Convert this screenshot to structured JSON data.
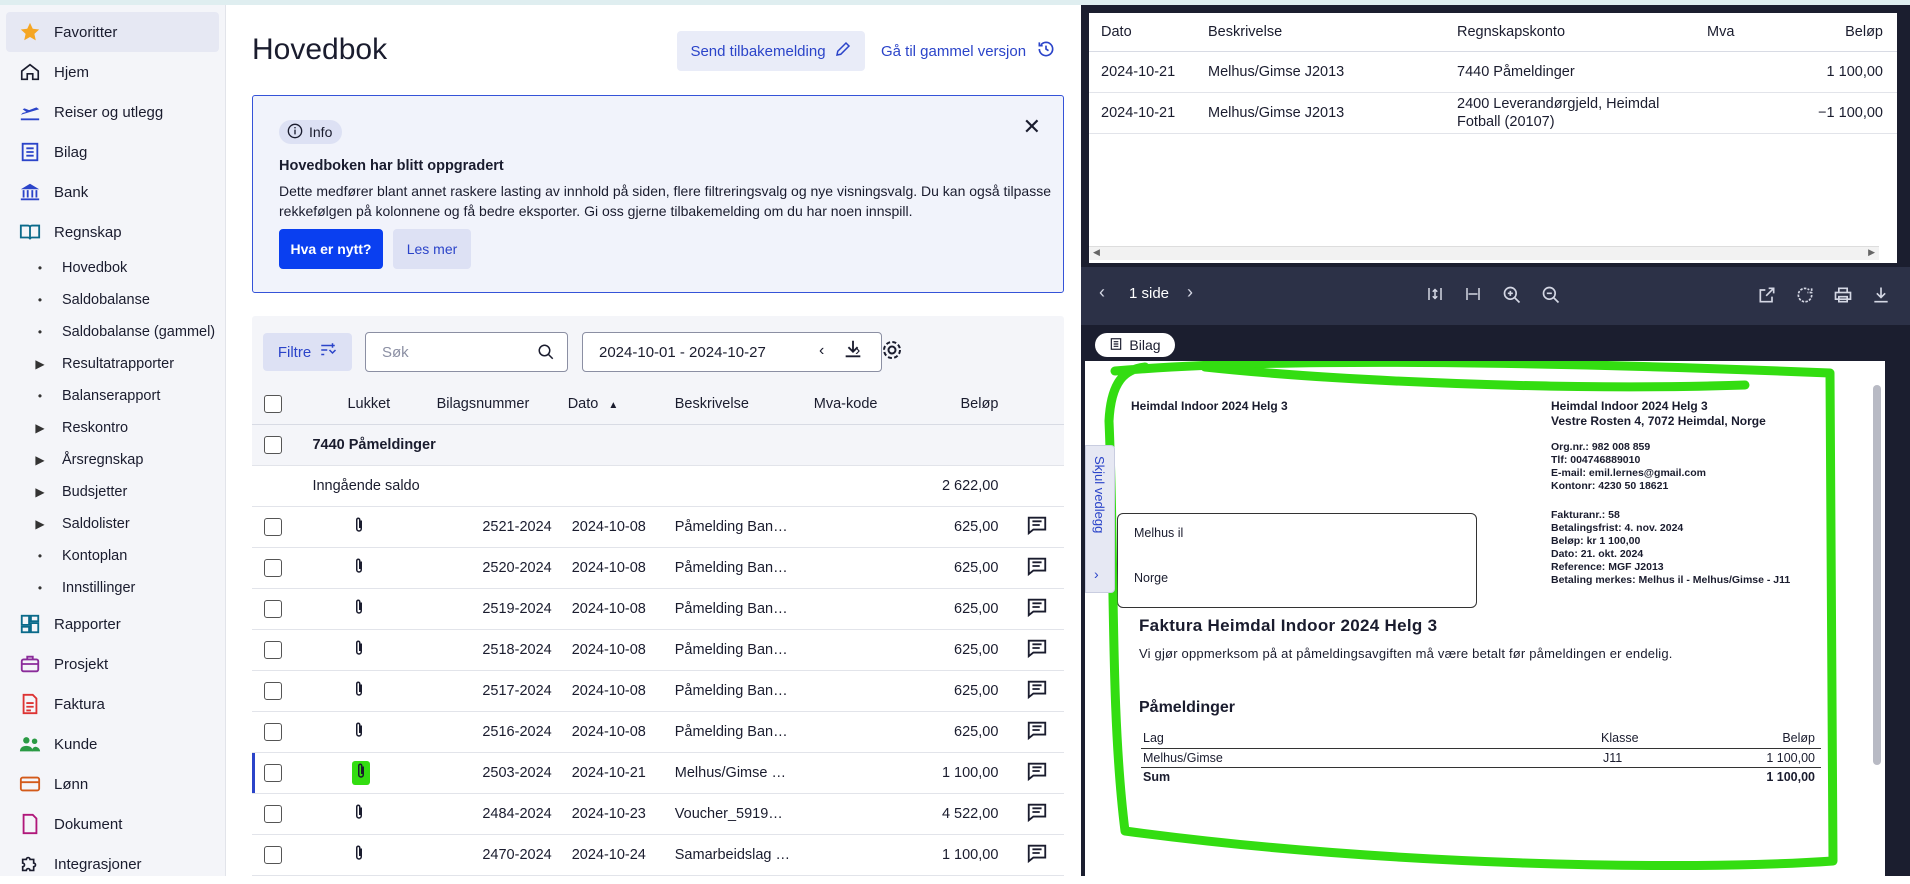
{
  "sidebar": {
    "items": [
      {
        "label": "Favoritter",
        "icon": "star-icon"
      },
      {
        "label": "Hjem",
        "icon": "home-icon"
      },
      {
        "label": "Reiser og utlegg",
        "icon": "plane-icon"
      },
      {
        "label": "Bilag",
        "icon": "document-list-icon"
      },
      {
        "label": "Bank",
        "icon": "bank-icon"
      },
      {
        "label": "Regnskap",
        "icon": "book-icon"
      }
    ],
    "sub_items": [
      {
        "label": "Hovedbok",
        "type": "dot"
      },
      {
        "label": "Saldobalanse",
        "type": "dot"
      },
      {
        "label": "Saldobalanse (gammel)",
        "type": "dot"
      },
      {
        "label": "Resultatrapporter",
        "type": "caret"
      },
      {
        "label": "Balanserapport",
        "type": "dot"
      },
      {
        "label": "Reskontro",
        "type": "caret"
      },
      {
        "label": "Årsregnskap",
        "type": "caret"
      },
      {
        "label": "Budsjetter",
        "type": "caret"
      },
      {
        "label": "Saldolister",
        "type": "caret"
      },
      {
        "label": "Kontoplan",
        "type": "dot"
      },
      {
        "label": "Innstillinger",
        "type": "dot"
      }
    ],
    "bottom_items": [
      {
        "label": "Rapporter",
        "icon": "dashboard-icon"
      },
      {
        "label": "Prosjekt",
        "icon": "briefcase-icon"
      },
      {
        "label": "Faktura",
        "icon": "invoice-icon"
      },
      {
        "label": "Kunde",
        "icon": "users-icon"
      },
      {
        "label": "Lønn",
        "icon": "wallet-icon"
      },
      {
        "label": "Dokument",
        "icon": "file-icon"
      },
      {
        "label": "Integrasjoner",
        "icon": "puzzle-icon"
      }
    ]
  },
  "header": {
    "title": "Hovedbok",
    "feedback_label": "Send tilbakemelding",
    "old_version_label": "Gå til gammel versjon"
  },
  "info": {
    "badge": "Info",
    "title": "Hovedboken har blitt oppgradert",
    "text": "Dette medfører blant annet raskere lasting av innhold på siden, flere filtreringsvalg og nye visningsvalg. Du kan også tilpasse rekkefølgen på kolonnene og få bedre eksporter. Gi oss gjerne tilbakemelding om du har noen innspill.",
    "primary": "Hva er nytt?",
    "secondary": "Les mer"
  },
  "toolbar": {
    "filter_label": "Filtre",
    "search_placeholder": "Søk",
    "date_range": "2024-10-01 - 2024-10-27"
  },
  "table": {
    "columns": [
      "Lukket",
      "Bilagsnummer",
      "Dato",
      "Beskrivelse",
      "Mva-kode",
      "Beløp"
    ],
    "group": "7440 Påmeldinger",
    "opening_label": "Inngående saldo",
    "opening_amount": "2 622,00",
    "rows": [
      {
        "num": "2521-2024",
        "date": "2024-10-08",
        "desc": "Påmelding Ban…",
        "mva": "",
        "amount": "625,00",
        "selected": false
      },
      {
        "num": "2520-2024",
        "date": "2024-10-08",
        "desc": "Påmelding Ban…",
        "mva": "",
        "amount": "625,00",
        "selected": false
      },
      {
        "num": "2519-2024",
        "date": "2024-10-08",
        "desc": "Påmelding Ban…",
        "mva": "",
        "amount": "625,00",
        "selected": false
      },
      {
        "num": "2518-2024",
        "date": "2024-10-08",
        "desc": "Påmelding Ban…",
        "mva": "",
        "amount": "625,00",
        "selected": false
      },
      {
        "num": "2517-2024",
        "date": "2024-10-08",
        "desc": "Påmelding Ban…",
        "mva": "",
        "amount": "625,00",
        "selected": false
      },
      {
        "num": "2516-2024",
        "date": "2024-10-08",
        "desc": "Påmelding Ban…",
        "mva": "",
        "amount": "625,00",
        "selected": false
      },
      {
        "num": "2503-2024",
        "date": "2024-10-21",
        "desc": "Melhus/Gimse …",
        "mva": "",
        "amount": "1 100,00",
        "selected": true
      },
      {
        "num": "2484-2024",
        "date": "2024-10-23",
        "desc": "Voucher_5919…",
        "mva": "",
        "amount": "4 522,00",
        "selected": false
      },
      {
        "num": "2470-2024",
        "date": "2024-10-24",
        "desc": "Samarbeidslag …",
        "mva": "",
        "amount": "1 100,00",
        "selected": false
      }
    ]
  },
  "detail": {
    "columns": [
      "Dato",
      "Beskrivelse",
      "Regnskapskonto",
      "Mva",
      "Beløp"
    ],
    "rows": [
      {
        "date": "2024-10-21",
        "desc": "Melhus/Gimse J2013",
        "account": "7440 Påmeldinger",
        "mva": "",
        "amount": "1 100,00"
      },
      {
        "date": "2024-10-21",
        "desc": "Melhus/Gimse J2013",
        "account": "2400 Leverandørgjeld, Heimdal Fotball (20107)",
        "mva": "",
        "amount": "−1 100,00"
      }
    ]
  },
  "viewer": {
    "pages": "1 side",
    "chip": "Bilag",
    "hide_tab": "Skjul vedlegg"
  },
  "invoice": {
    "sender_left": "Heimdal Indoor 2024 Helg 3",
    "sender_name": "Heimdal Indoor 2024 Helg 3",
    "sender_address": "Vestre Rosten 4, 7072 Heimdal, Norge",
    "org": "Org.nr.: 982 008 859",
    "tlf": "Tlf: 004746889010",
    "email": "E-mail: emil.lernes@gmail.com",
    "kontonr": "Kontonr: 4230 50 18621",
    "fakturanr": "Fakturanr.: 58",
    "frist": "Betalingsfrist: 4. nov. 2024",
    "belop": "Beløp: kr 1 100,00",
    "dato": "Dato: 21. okt. 2024",
    "ref": "Reference: MGF J2013",
    "merkes": "Betaling merkes: Melhus il - Melhus/Gimse - J11",
    "recipient_name": "Melhus il",
    "recipient_country": "Norge",
    "heading": "Faktura Heimdal Indoor 2024 Helg 3",
    "notice": "Vi gjør oppmerksom på at påmeldingsavgiften må være betalt før påmeldingen er endelig.",
    "section": "Påmeldinger",
    "col_lag": "Lag",
    "col_klasse": "Klasse",
    "col_belop": "Beløp",
    "line_lag": "Melhus/Gimse",
    "line_klasse": "J11",
    "line_belop": "1 100,00",
    "sum_label": "Sum",
    "sum_value": "1 100,00"
  },
  "colors": {
    "accent": "#2b44c9",
    "primary": "#0a3ff0",
    "highlight": "#33dd11",
    "dark": "#1b1e2f"
  }
}
